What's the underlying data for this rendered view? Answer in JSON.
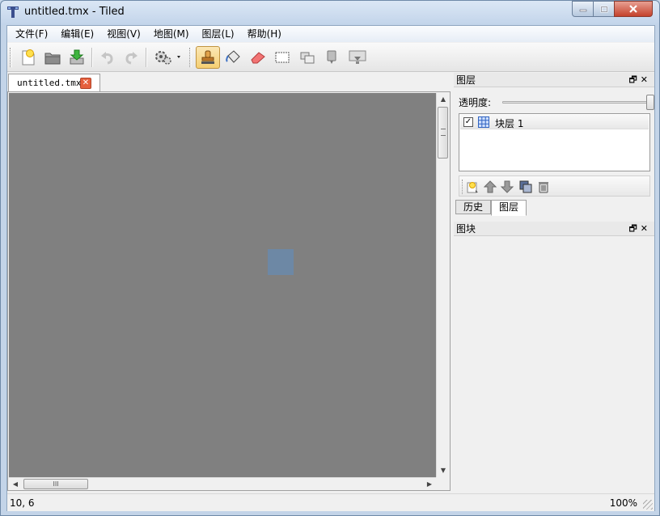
{
  "window": {
    "title": "untitled.tmx - Tiled",
    "controls": {
      "minimize": "minimize",
      "maximize": "maximize",
      "close": "close"
    }
  },
  "menu": {
    "items": [
      {
        "label": "文件(F)"
      },
      {
        "label": "编辑(E)"
      },
      {
        "label": "视图(V)"
      },
      {
        "label": "地图(M)"
      },
      {
        "label": "图层(L)"
      },
      {
        "label": "帮助(H)"
      }
    ]
  },
  "toolbar": {
    "buttons": [
      {
        "icon": "new-map-icon"
      },
      {
        "icon": "open-folder-icon"
      },
      {
        "icon": "save-icon"
      },
      {
        "icon": "undo-icon"
      },
      {
        "icon": "redo-icon"
      },
      {
        "icon": "commands-gear-icon"
      },
      {
        "icon": "stamp-brush-icon",
        "active": true
      },
      {
        "icon": "bucket-fill-icon"
      },
      {
        "icon": "eraser-icon"
      },
      {
        "icon": "rect-select-icon"
      },
      {
        "icon": "select-same-tile-icon"
      },
      {
        "icon": "object-select-icon"
      },
      {
        "icon": "edit-polygon-icon"
      }
    ]
  },
  "document": {
    "tab_label": "untitled.tmx",
    "tab_close": "✕",
    "hscroll_thumb": "III",
    "canvas_color": "#808080",
    "cursor_color": "#6d88a5"
  },
  "layers_panel": {
    "title": "图层",
    "opacity_label": "透明度:",
    "opacity_value": 1.0,
    "layers": [
      {
        "name": "块层 1",
        "visible": true,
        "checkmark": "✓"
      }
    ],
    "tabs": [
      {
        "label": "历史",
        "selected": false
      },
      {
        "label": "图层",
        "selected": true
      }
    ]
  },
  "tiles_panel": {
    "title": "图块"
  },
  "dock_buttons": "🗗✕",
  "status": {
    "position": "10, 6",
    "zoom": "100%"
  }
}
